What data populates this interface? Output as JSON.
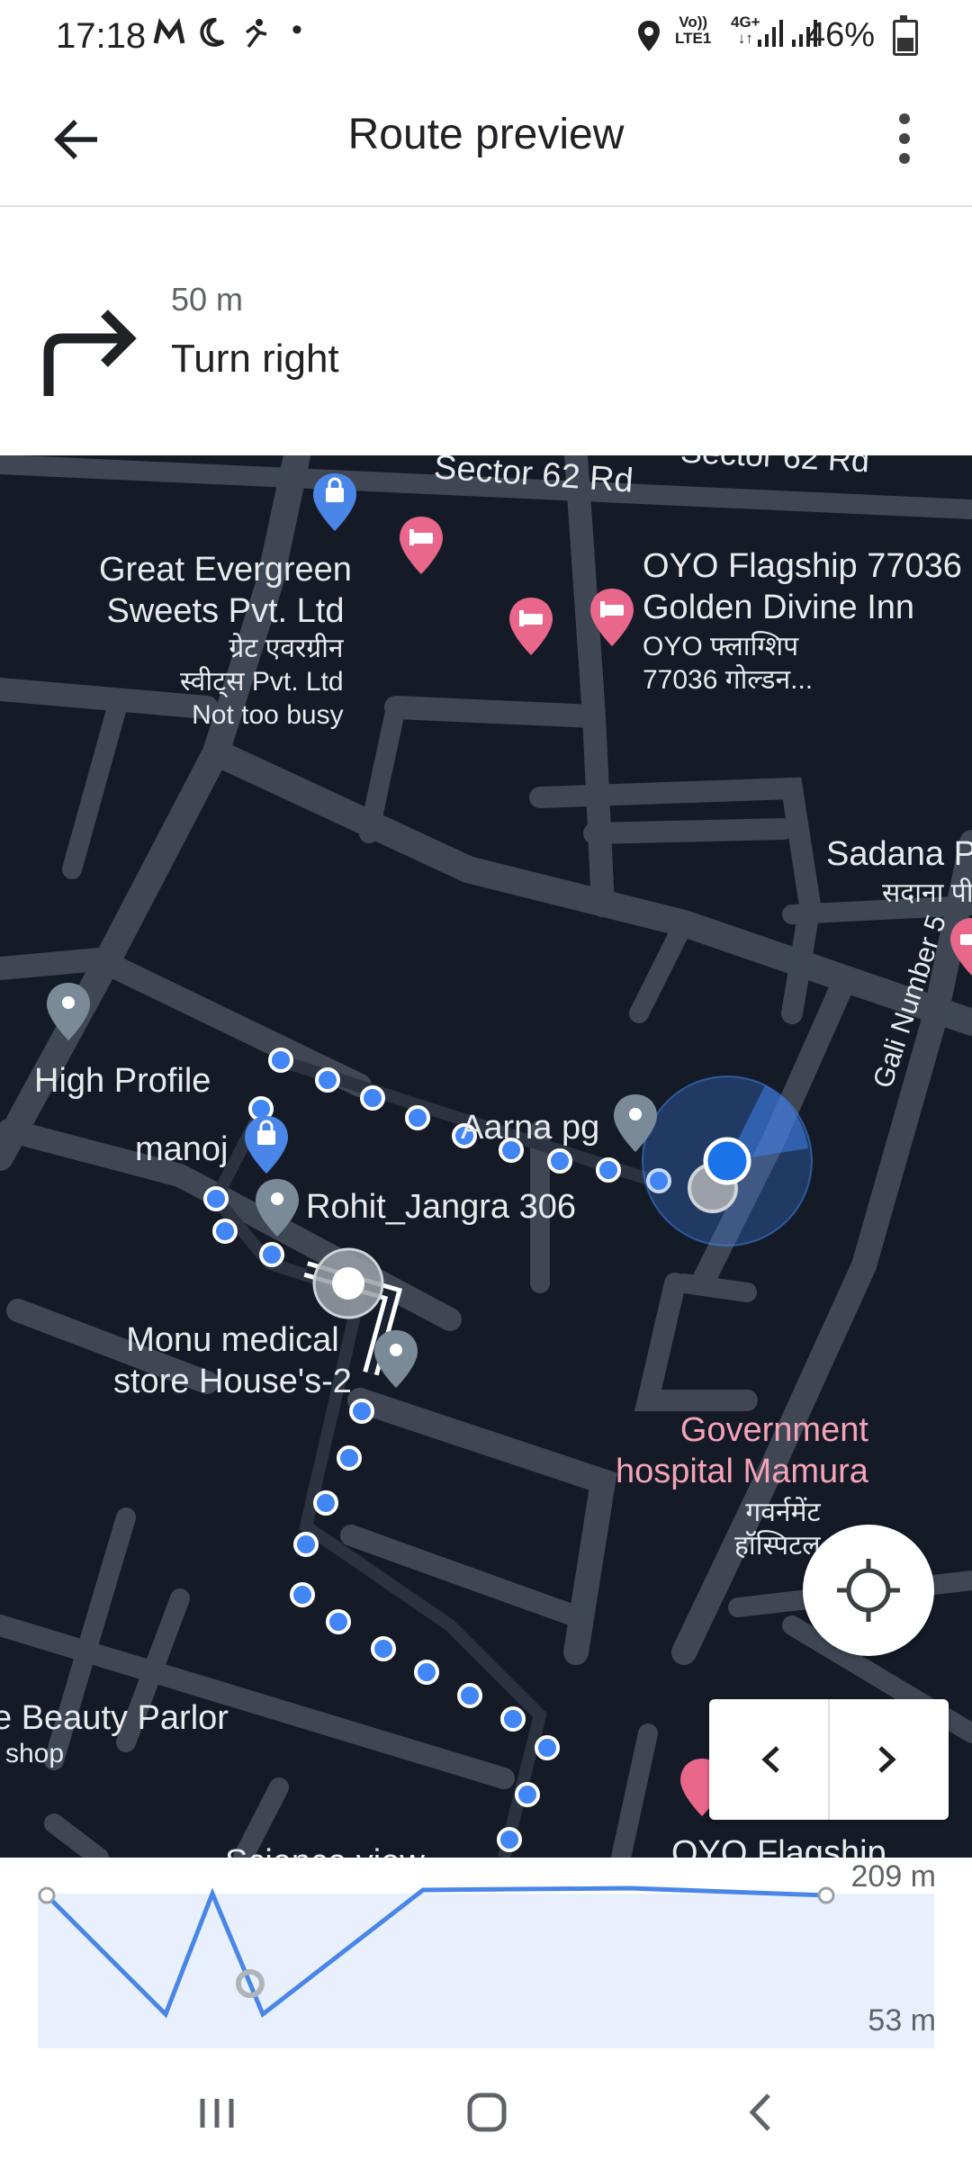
{
  "status": {
    "time": "17:18",
    "net_top": "Vo))",
    "net_bottom": "LTE1",
    "net4g_top": "4G+",
    "battery": "46%"
  },
  "appbar": {
    "title": "Route preview",
    "back_icon": "arrow-back-icon",
    "more_icon": "more-vert-icon"
  },
  "step": {
    "distance": "50 m",
    "instruction": "Turn right",
    "icon": "turn-right-icon"
  },
  "map": {
    "roads": [
      "Sector 62 Rd",
      "Sector 62 Rd",
      "Gali Number 5"
    ],
    "places": {
      "great_evergreen": [
        "Great Evergreen",
        "Sweets Pvt. Ltd"
      ],
      "great_evergreen_hi": [
        "ग्रेट एवरग्रीन",
        "स्वीट्स Pvt. Ltd"
      ],
      "great_evergreen_busy": "Not too busy",
      "oyo_flagship": [
        "OYO Flagship 77036",
        "Golden Divine Inn"
      ],
      "oyo_flagship_hi": [
        "OYO फ्लाग्शिप",
        "77036 गोल्डन..."
      ],
      "sadana": "Sadana P",
      "sadana_hi": "सदाना पी",
      "high_profile": "High Profile",
      "manoj": "manoj",
      "aarna": "Aarna pg",
      "rohit": "Rohit_Jangra 306",
      "monu": [
        "Monu medical",
        "store House's-2"
      ],
      "gov_hospital": [
        "Government",
        "hospital Mamura"
      ],
      "gov_hospital_hi": [
        "गवर्नमेंट",
        "हॉस्पिटल"
      ],
      "beauty_parlor": "e Beauty Parlor",
      "beauty_shop": "shop",
      "science_view": "Science view",
      "oyo_bottom": "OYO Flagship"
    }
  },
  "controls": {
    "locate_icon": "my-location-icon",
    "prev_icon": "chevron-left-icon",
    "next_icon": "chevron-right-icon"
  },
  "elevation": {
    "max_label": "209 m",
    "min_label": "53 m"
  },
  "navbar": {
    "recents_icon": "recents-icon",
    "home_icon": "home-icon",
    "back_icon": "back-nav-icon"
  }
}
